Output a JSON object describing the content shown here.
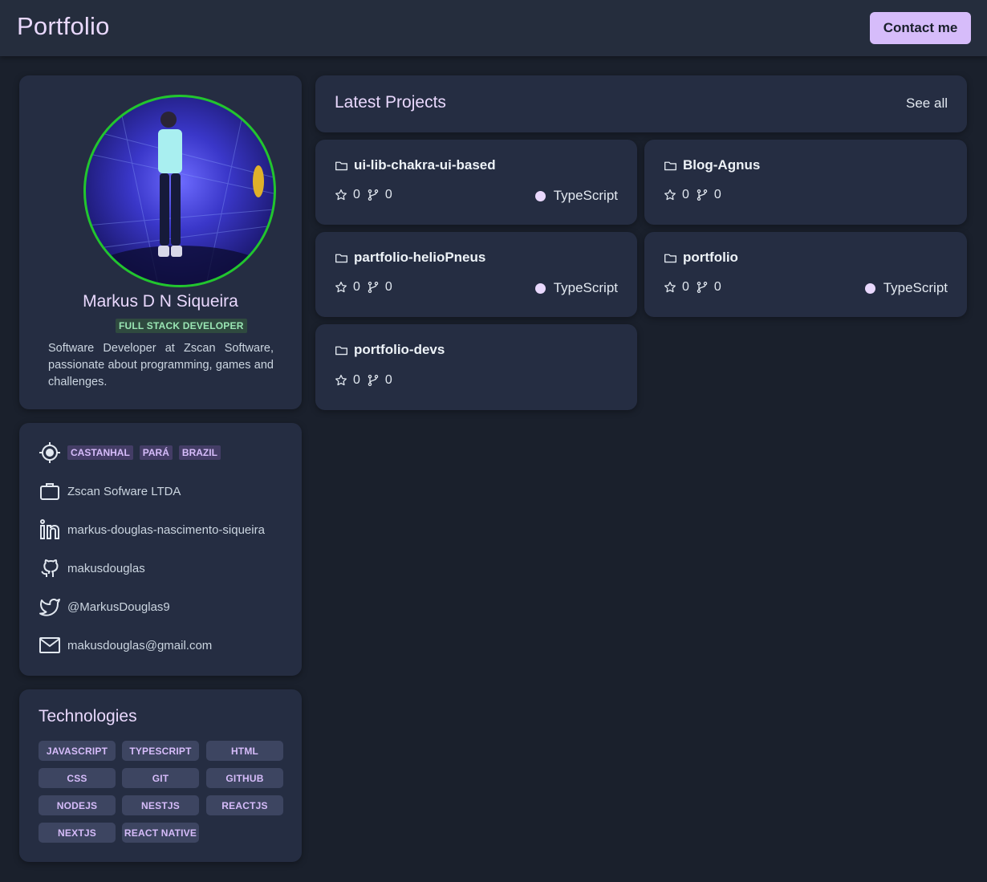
{
  "header": {
    "brand": "Portfolio",
    "contact_label": "Contact me"
  },
  "profile": {
    "name": "Markus D N Siqueira",
    "role": "FULL STACK DEVELOPER",
    "bio": "Software Developer at Zscan Software, passionate about programming, games and challenges."
  },
  "info": {
    "location": [
      "CASTANHAL",
      "PARÁ",
      "BRAZIL"
    ],
    "company": "Zscan Sofware LTDA",
    "linkedin": "markus-douglas-nascimento-siqueira",
    "github": "makusdouglas",
    "twitter": "@MarkusDouglas9",
    "email": "makusdouglas@gmail.com"
  },
  "technologies": {
    "title": "Technologies",
    "items": [
      "JAVASCRIPT",
      "TYPESCRIPT",
      "HTML",
      "CSS",
      "GIT",
      "GITHUB",
      "NODEJS",
      "NESTJS",
      "REACTJS",
      "NEXTJS",
      "REACT NATIVE"
    ]
  },
  "projects": {
    "title": "Latest Projects",
    "see_all": "See all",
    "items": [
      {
        "name": "ui-lib-chakra-ui-based",
        "stars": "0",
        "forks": "0",
        "language": "TypeScript"
      },
      {
        "name": "Blog-Agnus",
        "stars": "0",
        "forks": "0",
        "language": ""
      },
      {
        "name": "partfolio-helioPneus",
        "stars": "0",
        "forks": "0",
        "language": "TypeScript"
      },
      {
        "name": "portfolio",
        "stars": "0",
        "forks": "0",
        "language": "TypeScript"
      },
      {
        "name": "portfolio-devs",
        "stars": "0",
        "forks": "0",
        "language": ""
      }
    ]
  },
  "colors": {
    "accent": "#d6bcfa",
    "avatar_ring": "#22c52e",
    "typescript_dot": "#e9d8fd",
    "background": "#1a202c",
    "card": "#252d42"
  },
  "icons": {
    "location": "crosshair-icon",
    "company": "briefcase-icon",
    "linkedin": "linkedin-icon",
    "github": "github-icon",
    "twitter": "twitter-icon",
    "email": "mail-icon",
    "project": "folder-icon",
    "stars": "star-icon",
    "forks": "git-fork-icon"
  }
}
